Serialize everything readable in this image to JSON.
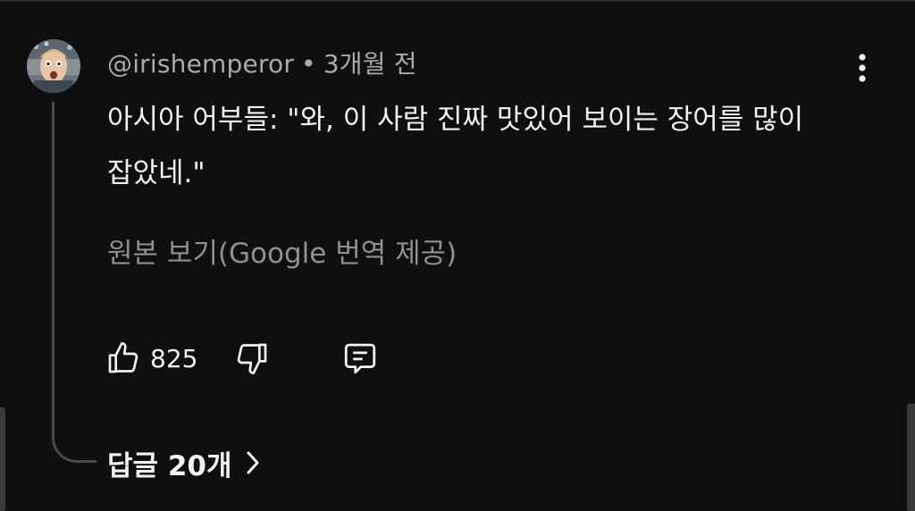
{
  "comment": {
    "author": "@irishemperor",
    "separator": "•",
    "timestamp": "3개월 전",
    "text": "아시아 어부들: \"와, 이 사람 진짜 맛있어 보이는 장어를 많이 잡았네.\"",
    "translate_link": "원본 보기(Google 번역 제공)",
    "likes": "825",
    "replies_label": "답글 20개"
  },
  "icons": {
    "more": "more-vert-icon",
    "like": "thumbs-up-icon",
    "dislike": "thumbs-down-icon",
    "reply": "comment-icon",
    "chevron": "chevron-right-icon"
  },
  "colors": {
    "background": "#0f0f0f",
    "primary_text": "#f1f1f1",
    "secondary_text": "#aaaaaa",
    "link_text": "#909090"
  }
}
